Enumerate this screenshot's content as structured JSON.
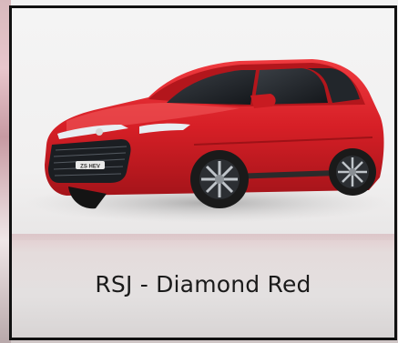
{
  "swatch": {
    "caption": "RSJ - Diamond Red",
    "color": "#d61f26",
    "badge_text": "ZS HEV"
  }
}
